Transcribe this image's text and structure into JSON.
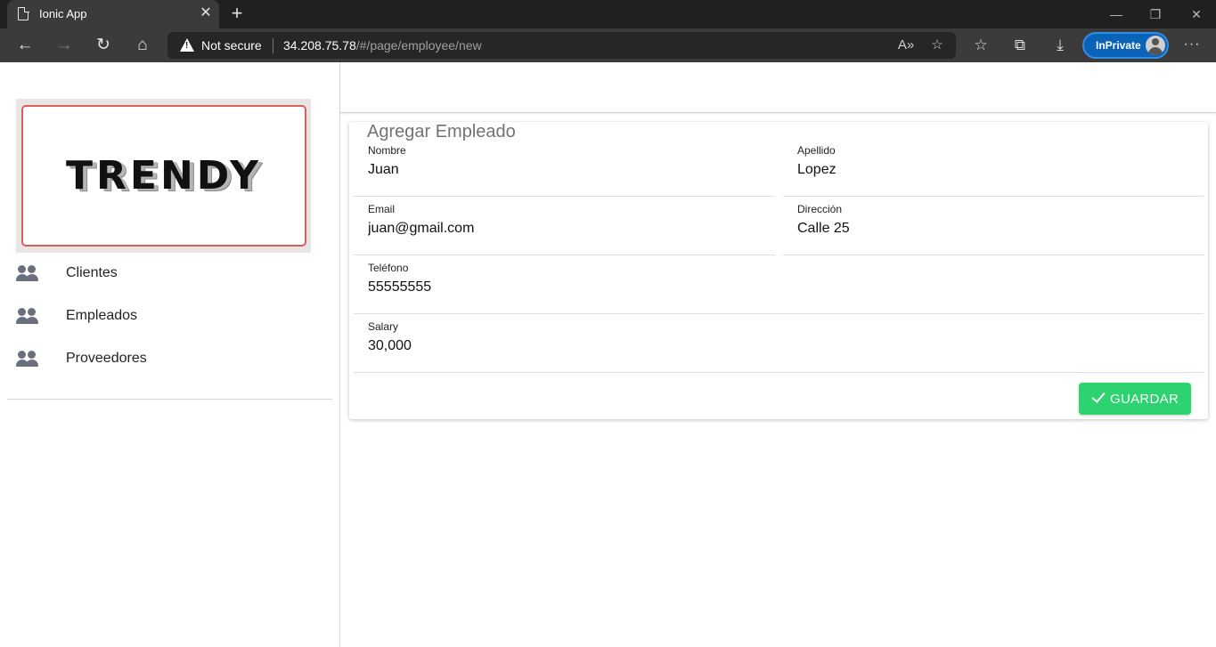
{
  "browser": {
    "tab_title": "Ionic App",
    "address": {
      "security_label": "Not secure",
      "host": "34.208.75.78",
      "path": "/#/page/employee/new"
    },
    "inprivate_label": "InPrivate"
  },
  "menu": {
    "logo_text": "TRENDY",
    "items": [
      {
        "label": "Clientes",
        "icon": "people-icon"
      },
      {
        "label": "Empleados",
        "icon": "people-icon"
      },
      {
        "label": "Proveedores",
        "icon": "people-icon"
      }
    ]
  },
  "form": {
    "title": "Agregar Empleado",
    "fields": {
      "nombre": {
        "label": "Nombre",
        "value": "Juan"
      },
      "apellido": {
        "label": "Apellido",
        "value": "Lopez"
      },
      "email": {
        "label": "Email",
        "value": "juan@gmail.com"
      },
      "direccion": {
        "label": "Dirección",
        "value": "Calle 25"
      },
      "telefono": {
        "label": "Teléfono",
        "value": "55555555"
      },
      "salary": {
        "label": "Salary",
        "value": "30,000"
      }
    },
    "save_label": "GUARDAR"
  },
  "colors": {
    "success": "#2dd36f",
    "logo_border": "#d8605c",
    "inprivate": "#0b63b8"
  }
}
